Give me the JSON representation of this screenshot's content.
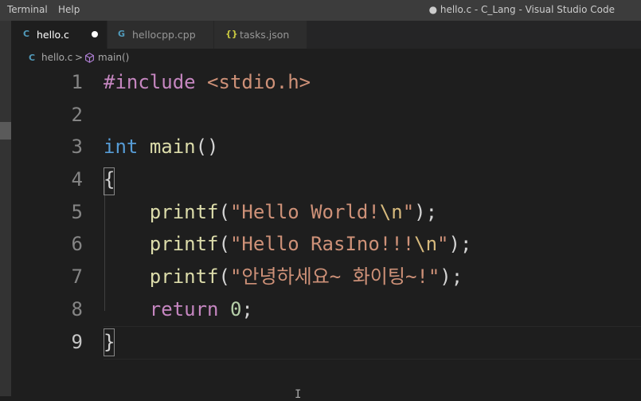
{
  "titlebar": {
    "menu": [
      "Terminal",
      "Help"
    ],
    "window_title": "● hello.c - C_Lang - Visual Studio Code"
  },
  "tabs": [
    {
      "icon": "C",
      "label": "hello.c",
      "active": true,
      "dirty": true
    },
    {
      "icon": "G",
      "label": "hellocpp.cpp",
      "active": false
    },
    {
      "icon": "{}",
      "label": "tasks.json",
      "active": false
    }
  ],
  "breadcrumb": {
    "file_icon": "C",
    "file": "hello.c",
    "separator": ">",
    "symbol": "main()"
  },
  "editor": {
    "line_numbers": [
      "1",
      "2",
      "3",
      "4",
      "5",
      "6",
      "7",
      "8",
      "9"
    ],
    "current_line": "9",
    "lines": [
      [
        {
          "t": "#include ",
          "c": "pre"
        },
        {
          "t": "<stdio.h>",
          "c": "str"
        }
      ],
      [],
      [
        {
          "t": "int",
          "c": "kw"
        },
        {
          "t": " ",
          "c": "punc"
        },
        {
          "t": "main",
          "c": "fn"
        },
        {
          "t": "()",
          "c": "punc"
        }
      ],
      [
        {
          "t": "{",
          "c": "punc"
        }
      ],
      [
        {
          "t": "    ",
          "c": "punc"
        },
        {
          "t": "printf",
          "c": "fn"
        },
        {
          "t": "(",
          "c": "punc"
        },
        {
          "t": "\"Hello World!",
          "c": "str"
        },
        {
          "t": "\\n",
          "c": "esc"
        },
        {
          "t": "\"",
          "c": "str"
        },
        {
          "t": ");",
          "c": "punc"
        }
      ],
      [
        {
          "t": "    ",
          "c": "punc"
        },
        {
          "t": "printf",
          "c": "fn"
        },
        {
          "t": "(",
          "c": "punc"
        },
        {
          "t": "\"Hello RasIno!!!",
          "c": "str"
        },
        {
          "t": "\\n",
          "c": "esc"
        },
        {
          "t": "\"",
          "c": "str"
        },
        {
          "t": ");",
          "c": "punc"
        }
      ],
      [
        {
          "t": "    ",
          "c": "punc"
        },
        {
          "t": "printf",
          "c": "fn"
        },
        {
          "t": "(",
          "c": "punc"
        },
        {
          "t": "\"안녕하세요~ 화이팅~!\"",
          "c": "str"
        },
        {
          "t": ");",
          "c": "punc"
        }
      ],
      [
        {
          "t": "    ",
          "c": "punc"
        },
        {
          "t": "return",
          "c": "ctrl"
        },
        {
          "t": " ",
          "c": "punc"
        },
        {
          "t": "0",
          "c": "num"
        },
        {
          "t": ";",
          "c": "punc"
        }
      ],
      [
        {
          "t": "}",
          "c": "punc"
        }
      ]
    ]
  },
  "colors": {
    "background": "#1e1e1e",
    "titlebar": "#3c3c3c",
    "tabbar": "#252526",
    "string": "#ce9178",
    "keyword": "#569cd6",
    "function": "#dcdcaa",
    "control": "#c586c0",
    "escape": "#d7ba7d"
  },
  "icons": {
    "c_file": "c-file-icon",
    "cpp_file": "cpp-file-icon",
    "json_file": "json-file-icon",
    "symbol": "symbol-method-icon",
    "modified": "modified-dot-icon",
    "text_cursor": "i-beam-cursor-icon"
  }
}
